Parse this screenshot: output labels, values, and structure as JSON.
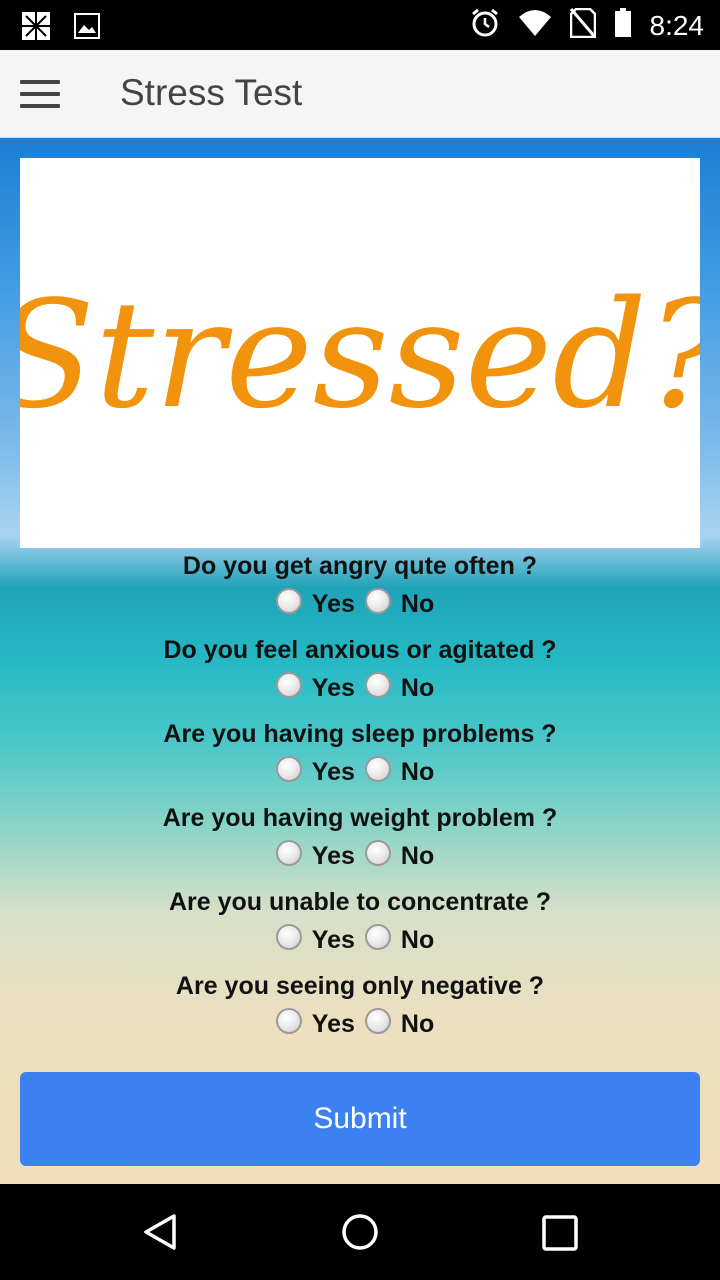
{
  "status_bar": {
    "time": "8:24",
    "icons": [
      "notification-icon",
      "image-icon",
      "alarm-icon",
      "wifi-icon",
      "no-sim-icon",
      "battery-icon"
    ]
  },
  "app_bar": {
    "title": "Stress Test",
    "menu_icon": "hamburger-menu-icon"
  },
  "hero": {
    "image_text": "Stressed?",
    "color": "#f2930d"
  },
  "questions": [
    {
      "text": "Do you get angry qute often ?",
      "yes": "Yes",
      "no": "No"
    },
    {
      "text": "Do you feel anxious or agitated ?",
      "yes": "Yes",
      "no": "No"
    },
    {
      "text": "Are you having sleep problems ?",
      "yes": "Yes",
      "no": "No"
    },
    {
      "text": "Are you having weight problem ?",
      "yes": "Yes",
      "no": "No"
    },
    {
      "text": "Are you unable to concentrate ?",
      "yes": "Yes",
      "no": "No"
    },
    {
      "text": "Are you seeing only negative ?",
      "yes": "Yes",
      "no": "No"
    }
  ],
  "submit_label": "Submit",
  "colors": {
    "accent": "#3b82f0",
    "app_bar_bg": "#f5f5f5"
  }
}
